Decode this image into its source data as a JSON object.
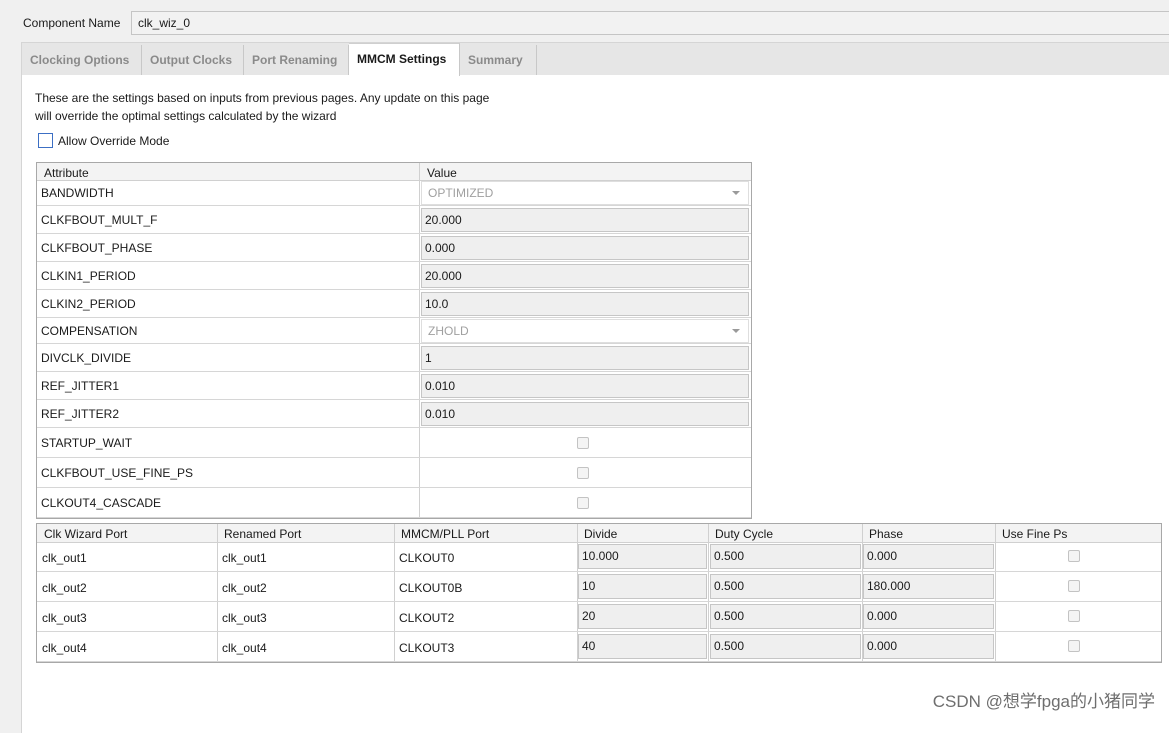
{
  "component": {
    "label": "Component Name",
    "value": "clk_wiz_0"
  },
  "tabs": [
    {
      "label": "Clocking Options",
      "active": false
    },
    {
      "label": "Output Clocks",
      "active": false
    },
    {
      "label": "Port Renaming",
      "active": false
    },
    {
      "label": "MMCM Settings",
      "active": true
    },
    {
      "label": "Summary",
      "active": false
    }
  ],
  "description": {
    "line1": "These are the settings based on inputs from previous pages. Any update on this page",
    "line2": "will override the optimal settings calculated by the wizard"
  },
  "override": {
    "label": "Allow Override Mode",
    "checked": false
  },
  "attributes": {
    "headers": {
      "attribute": "Attribute",
      "value": "Value"
    },
    "rows": [
      {
        "name": "BANDWIDTH",
        "type": "combo",
        "value": "OPTIMIZED"
      },
      {
        "name": "CLKFBOUT_MULT_F",
        "type": "text",
        "value": "20.000"
      },
      {
        "name": "CLKFBOUT_PHASE",
        "type": "text",
        "value": "0.000"
      },
      {
        "name": "CLKIN1_PERIOD",
        "type": "text",
        "value": "20.000"
      },
      {
        "name": "CLKIN2_PERIOD",
        "type": "text",
        "value": "10.0"
      },
      {
        "name": "COMPENSATION",
        "type": "combo",
        "value": "ZHOLD"
      },
      {
        "name": "DIVCLK_DIVIDE",
        "type": "text",
        "value": "1"
      },
      {
        "name": "REF_JITTER1",
        "type": "text",
        "value": "0.010"
      },
      {
        "name": "REF_JITTER2",
        "type": "text",
        "value": "0.010"
      },
      {
        "name": "STARTUP_WAIT",
        "type": "check",
        "value": false
      },
      {
        "name": "CLKFBOUT_USE_FINE_PS",
        "type": "check",
        "value": false
      },
      {
        "name": "CLKOUT4_CASCADE",
        "type": "check",
        "value": false
      }
    ]
  },
  "ports": {
    "headers": [
      "Clk Wizard Port",
      "Renamed Port",
      "MMCM/PLL Port",
      "Divide",
      "Duty Cycle",
      "Phase",
      "Use Fine Ps"
    ],
    "rows": [
      {
        "wizard": "clk_out1",
        "renamed": "clk_out1",
        "mmcm": "CLKOUT0",
        "divide": "10.000",
        "duty": "0.500",
        "phase": "0.000",
        "fine": false
      },
      {
        "wizard": "clk_out2",
        "renamed": "clk_out2",
        "mmcm": "CLKOUT0B",
        "divide": "10",
        "duty": "0.500",
        "phase": "180.000",
        "fine": false
      },
      {
        "wizard": "clk_out3",
        "renamed": "clk_out3",
        "mmcm": "CLKOUT2",
        "divide": "20",
        "duty": "0.500",
        "phase": "0.000",
        "fine": false
      },
      {
        "wizard": "clk_out4",
        "renamed": "clk_out4",
        "mmcm": "CLKOUT3",
        "divide": "40",
        "duty": "0.500",
        "phase": "0.000",
        "fine": false
      }
    ]
  },
  "watermark": "CSDN @想学fpga的小猪同学"
}
